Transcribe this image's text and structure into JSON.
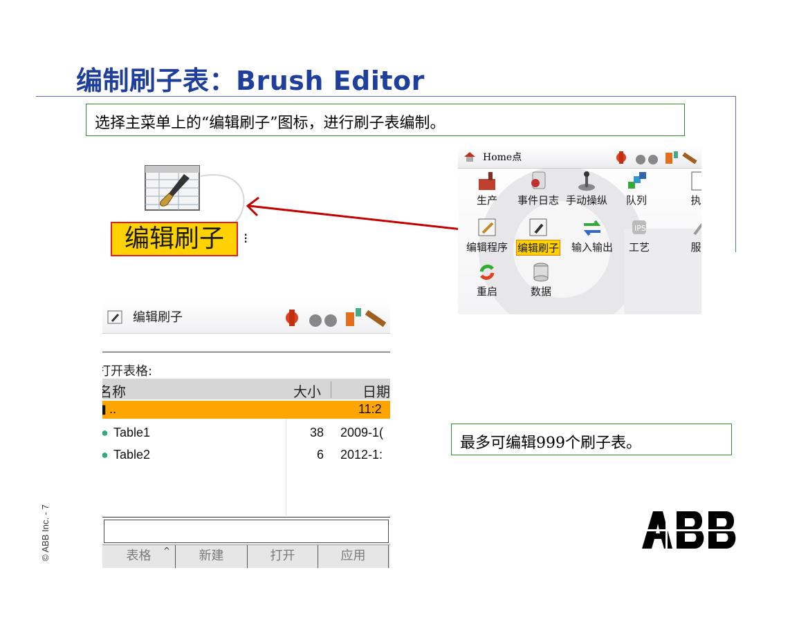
{
  "slide": {
    "title": "编制刷子表：Brush Editor",
    "callout_top": "选择主菜单上的“编辑刷子”图标，进行刷子表编制。",
    "callout_mid": "最多可编辑999个刷子表。",
    "copyright": "© ABB Inc. - 7",
    "logo": "ABB",
    "colors": {
      "title": "#1f3f9a",
      "highlight": "#ffd200",
      "arrow": "#c00000",
      "callout_border": "#2e8b2e"
    }
  },
  "big_icon": {
    "icon": "brush-table-icon",
    "label": "编辑刷子"
  },
  "home_screen": {
    "header_title": "Home点",
    "apps": [
      {
        "label": "生产",
        "icon": "production-icon"
      },
      {
        "label": "事件日志",
        "icon": "event-log-icon"
      },
      {
        "label": "手动操纵",
        "icon": "jog-icon"
      },
      {
        "label": "队列",
        "icon": "queue-icon"
      },
      {
        "label": "执",
        "icon": "execute-icon"
      },
      {
        "label": "编辑程序",
        "icon": "edit-program-icon"
      },
      {
        "label": "编辑刷子",
        "icon": "brush-editor-icon",
        "highlighted": true
      },
      {
        "label": "输入输出",
        "icon": "io-icon"
      },
      {
        "label": "工艺",
        "icon": "process-icon"
      },
      {
        "label": "服",
        "icon": "service-icon"
      },
      {
        "label": "重启",
        "icon": "restart-icon"
      },
      {
        "label": "数据",
        "icon": "data-icon"
      }
    ]
  },
  "editor": {
    "title": "编辑刷子",
    "open_label": "打开表格:",
    "columns": {
      "name": "名称",
      "size": "大小",
      "date": "日期"
    },
    "rows": [
      {
        "name": "..",
        "size": "",
        "date": "11:2"
      },
      {
        "name": "Table1",
        "size": "38",
        "date": "2009-1("
      },
      {
        "name": "Table2",
        "size": "6",
        "date": "2012-1:"
      }
    ],
    "toolbar": {
      "table": "表格",
      "new": "新建",
      "open": "打开",
      "apply": "应用"
    }
  }
}
